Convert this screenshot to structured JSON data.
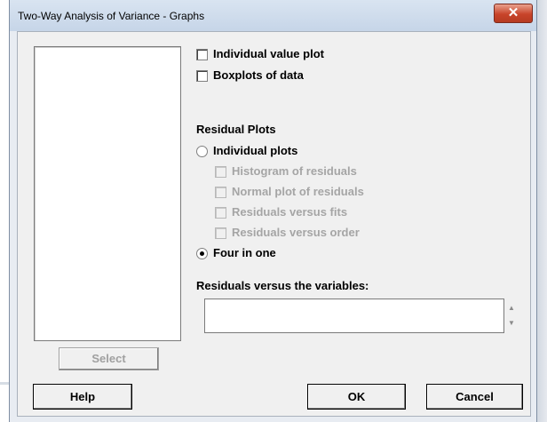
{
  "dialog": {
    "title": "Two-Way Analysis of Variance - Graphs",
    "close_glyph": "✕"
  },
  "options": {
    "individual_value_plot": {
      "label": "Individual value plot",
      "checked": false
    },
    "boxplots": {
      "label": "Boxplots of data",
      "checked": false
    }
  },
  "residual_plots": {
    "heading": "Residual Plots",
    "individual_plots": {
      "label": "Individual plots",
      "selected": false
    },
    "sub_options": [
      {
        "label": "Histogram of residuals",
        "checked": false
      },
      {
        "label": "Normal plot of residuals",
        "checked": false
      },
      {
        "label": "Residuals versus fits",
        "checked": false
      },
      {
        "label": "Residuals versus order",
        "checked": false
      }
    ],
    "four_in_one": {
      "label": "Four in one",
      "selected": true
    }
  },
  "residuals_vs_variables": {
    "label": "Residuals versus the variables:",
    "value": ""
  },
  "buttons": {
    "select": "Select",
    "help": "Help",
    "ok": "OK",
    "cancel": "Cancel"
  }
}
